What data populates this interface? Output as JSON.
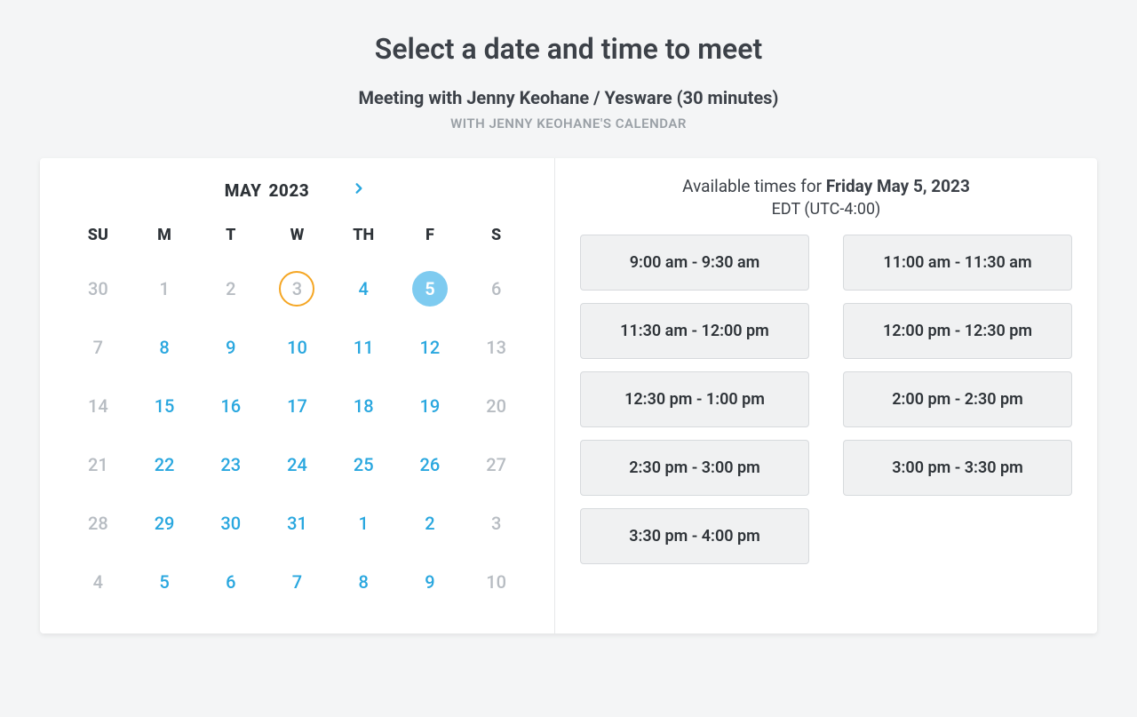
{
  "page": {
    "title": "Select a date and time to meet",
    "meeting_title": "Meeting with Jenny Keohane / Yesware (30 minutes)",
    "calendar_owner": "WITH JENNY KEOHANE'S CALENDAR"
  },
  "calendar": {
    "month": "MAY",
    "year": "2023",
    "weekdays": [
      "SU",
      "M",
      "T",
      "W",
      "TH",
      "F",
      "S"
    ],
    "days": [
      {
        "n": "30",
        "available": false,
        "today": false,
        "selected": false
      },
      {
        "n": "1",
        "available": false,
        "today": false,
        "selected": false
      },
      {
        "n": "2",
        "available": false,
        "today": false,
        "selected": false
      },
      {
        "n": "3",
        "available": false,
        "today": true,
        "selected": false
      },
      {
        "n": "4",
        "available": true,
        "today": false,
        "selected": false
      },
      {
        "n": "5",
        "available": true,
        "today": false,
        "selected": true
      },
      {
        "n": "6",
        "available": false,
        "today": false,
        "selected": false
      },
      {
        "n": "7",
        "available": false,
        "today": false,
        "selected": false
      },
      {
        "n": "8",
        "available": true,
        "today": false,
        "selected": false
      },
      {
        "n": "9",
        "available": true,
        "today": false,
        "selected": false
      },
      {
        "n": "10",
        "available": true,
        "today": false,
        "selected": false
      },
      {
        "n": "11",
        "available": true,
        "today": false,
        "selected": false
      },
      {
        "n": "12",
        "available": true,
        "today": false,
        "selected": false
      },
      {
        "n": "13",
        "available": false,
        "today": false,
        "selected": false
      },
      {
        "n": "14",
        "available": false,
        "today": false,
        "selected": false
      },
      {
        "n": "15",
        "available": true,
        "today": false,
        "selected": false
      },
      {
        "n": "16",
        "available": true,
        "today": false,
        "selected": false
      },
      {
        "n": "17",
        "available": true,
        "today": false,
        "selected": false
      },
      {
        "n": "18",
        "available": true,
        "today": false,
        "selected": false
      },
      {
        "n": "19",
        "available": true,
        "today": false,
        "selected": false
      },
      {
        "n": "20",
        "available": false,
        "today": false,
        "selected": false
      },
      {
        "n": "21",
        "available": false,
        "today": false,
        "selected": false
      },
      {
        "n": "22",
        "available": true,
        "today": false,
        "selected": false
      },
      {
        "n": "23",
        "available": true,
        "today": false,
        "selected": false
      },
      {
        "n": "24",
        "available": true,
        "today": false,
        "selected": false
      },
      {
        "n": "25",
        "available": true,
        "today": false,
        "selected": false
      },
      {
        "n": "26",
        "available": true,
        "today": false,
        "selected": false
      },
      {
        "n": "27",
        "available": false,
        "today": false,
        "selected": false
      },
      {
        "n": "28",
        "available": false,
        "today": false,
        "selected": false
      },
      {
        "n": "29",
        "available": true,
        "today": false,
        "selected": false
      },
      {
        "n": "30",
        "available": true,
        "today": false,
        "selected": false
      },
      {
        "n": "31",
        "available": true,
        "today": false,
        "selected": false
      },
      {
        "n": "1",
        "available": true,
        "today": false,
        "selected": false
      },
      {
        "n": "2",
        "available": true,
        "today": false,
        "selected": false
      },
      {
        "n": "3",
        "available": false,
        "today": false,
        "selected": false
      },
      {
        "n": "4",
        "available": false,
        "today": false,
        "selected": false
      },
      {
        "n": "5",
        "available": true,
        "today": false,
        "selected": false
      },
      {
        "n": "6",
        "available": true,
        "today": false,
        "selected": false
      },
      {
        "n": "7",
        "available": true,
        "today": false,
        "selected": false
      },
      {
        "n": "8",
        "available": true,
        "today": false,
        "selected": false
      },
      {
        "n": "9",
        "available": true,
        "today": false,
        "selected": false
      },
      {
        "n": "10",
        "available": false,
        "today": false,
        "selected": false
      }
    ]
  },
  "times": {
    "header_prefix": "Available times for ",
    "header_date": "Friday May 5, 2023",
    "timezone": "EDT (UTC-4:00)",
    "slots": [
      "9:00 am - 9:30 am",
      "11:00 am - 11:30 am",
      "11:30 am - 12:00 pm",
      "12:00 pm - 12:30 pm",
      "12:30 pm - 1:00 pm",
      "2:00 pm - 2:30 pm",
      "2:30 pm - 3:00 pm",
      "3:00 pm - 3:30 pm",
      "3:30 pm - 4:00 pm"
    ]
  }
}
